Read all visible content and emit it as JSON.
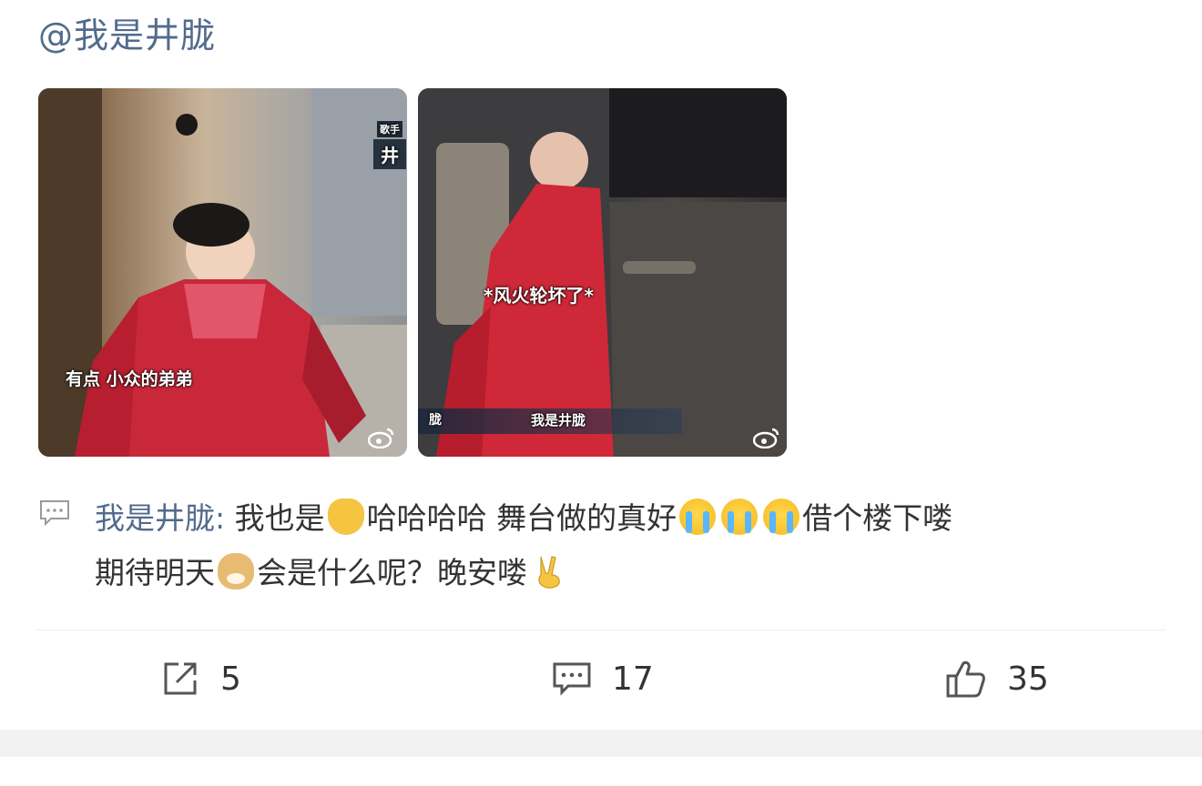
{
  "mention": "@我是井胧",
  "images": [
    {
      "caption": "有点 小众的弟弟",
      "corner_tag": "歌手",
      "corner_name": "井"
    },
    {
      "caption": "*风火轮坏了*",
      "name_bar_left": "胧",
      "name_bar_right": "我是井胧"
    }
  ],
  "repost": {
    "author": "我是井胧",
    "separator": ": ",
    "segment_1": "我也是",
    "segment_2": "哈哈哈哈 舞台做的真好",
    "segment_3": "借个楼下喽",
    "segment_4": "期待明天",
    "segment_5": "会是什么呢？晚安喽",
    "emoji_icons": [
      "raising-hand-icon",
      "crying-icon",
      "crying-icon",
      "crying-icon",
      "doge-icon",
      "victory-hand-icon"
    ]
  },
  "actions": {
    "repost_count": "5",
    "comment_count": "17",
    "like_count": "35"
  },
  "colors": {
    "link": "#526b8c",
    "text": "#333333",
    "divider": "#ececec"
  }
}
